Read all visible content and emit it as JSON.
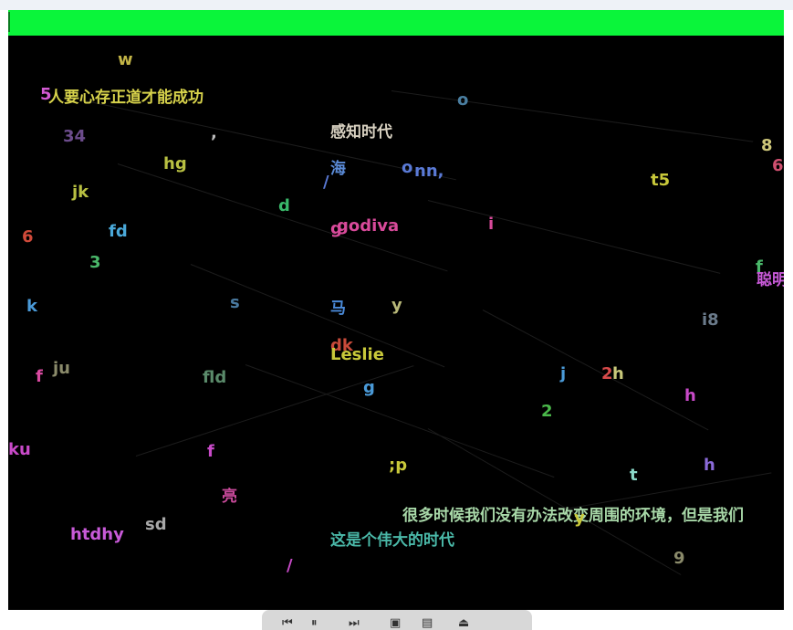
{
  "words": [
    {
      "text": "w",
      "color": "#c2b446"
    },
    {
      "text": "5",
      "color": "#d35ad3"
    },
    {
      "text": "人要心存正道才能成功",
      "color": "#d7d24b"
    },
    {
      "text": "o",
      "color": "#4a7ea0"
    },
    {
      "text": "34",
      "color": "#6c4c8c"
    },
    {
      "text": ",",
      "color": "#bbbbbb"
    },
    {
      "text": "感知时代",
      "color": "#d7d0c0"
    },
    {
      "text": "8",
      "color": "#cfc87a"
    },
    {
      "text": "6",
      "color": "#d05070"
    },
    {
      "text": "hg",
      "color": "#b8c042"
    },
    {
      "text": "海",
      "color": "#5a8ad6"
    },
    {
      "text": "o",
      "color": "#5a7ad6"
    },
    {
      "text": "nn,",
      "color": "#5a7ad6"
    },
    {
      "text": "t5",
      "color": "#c8c83a"
    },
    {
      "text": "jk",
      "color": "#b8c042"
    },
    {
      "text": "/",
      "color": "#5a7ad6"
    },
    {
      "text": "d",
      "color": "#3ab86a"
    },
    {
      "text": "g",
      "color": "#d84a9a"
    },
    {
      "text": "godiva",
      "color": "#d84a9a"
    },
    {
      "text": "i",
      "color": "#d84a9a"
    },
    {
      "text": "6",
      "color": "#d04a3a"
    },
    {
      "text": "fd",
      "color": "#4aa8d8"
    },
    {
      "text": "3",
      "color": "#4ab86a"
    },
    {
      "text": "f",
      "color": "#4ab86a"
    },
    {
      "text": "聪明",
      "color": "#c85ad8"
    },
    {
      "text": "k",
      "color": "#4a9ad8"
    },
    {
      "text": "s",
      "color": "#4a7aa0"
    },
    {
      "text": "马",
      "color": "#4a8ad8"
    },
    {
      "text": "y",
      "color": "#b8b878"
    },
    {
      "text": "i8",
      "color": "#6a7a8a"
    },
    {
      "text": "dk",
      "color": "#c84a3a"
    },
    {
      "text": "Leslie",
      "color": "#c8c83a"
    },
    {
      "text": "f",
      "color": "#d84aa0"
    },
    {
      "text": "ju",
      "color": "#8a8a6a"
    },
    {
      "text": "fld",
      "color": "#5a8a6a"
    },
    {
      "text": "j",
      "color": "#4a9ad8"
    },
    {
      "text": "2",
      "color": "#d84a4a"
    },
    {
      "text": "h",
      "color": "#c8c87a"
    },
    {
      "text": "g",
      "color": "#4a9ad8"
    },
    {
      "text": "h",
      "color": "#c84ac8"
    },
    {
      "text": "2",
      "color": "#4ab84a"
    },
    {
      "text": "ku",
      "color": "#c84ac8"
    },
    {
      "text": "f",
      "color": "#c84ac8"
    },
    {
      "text": ";p",
      "color": "#c8c83a"
    },
    {
      "text": "t",
      "color": "#8ad8c8"
    },
    {
      "text": "h",
      "color": "#8a6ad8"
    },
    {
      "text": "亮",
      "color": "#c84a9a"
    },
    {
      "text": "很多时候我们没有办法改变周围的环境，但是我们",
      "color": "#a8d8a8"
    },
    {
      "text": "y",
      "color": "#c8c83a"
    },
    {
      "text": "htdhy",
      "color": "#c85ad8"
    },
    {
      "text": "sd",
      "color": "#a8a8a8"
    },
    {
      "text": "这是个伟大的时代",
      "color": "#4ab8a8"
    },
    {
      "text": "9",
      "color": "#8a8a6a"
    },
    {
      "text": "/",
      "color": "#c84ac8"
    }
  ],
  "controls": [
    {
      "name": "prev-frame-icon",
      "glyph": "⏮"
    },
    {
      "name": "pause-icon",
      "glyph": "⏸"
    },
    {
      "name": "next-frame-icon",
      "glyph": "⏭"
    },
    {
      "name": "save-icon",
      "glyph": "▣"
    },
    {
      "name": "save-all-icon",
      "glyph": "▤"
    },
    {
      "name": "eject-icon",
      "glyph": "⏏"
    }
  ]
}
